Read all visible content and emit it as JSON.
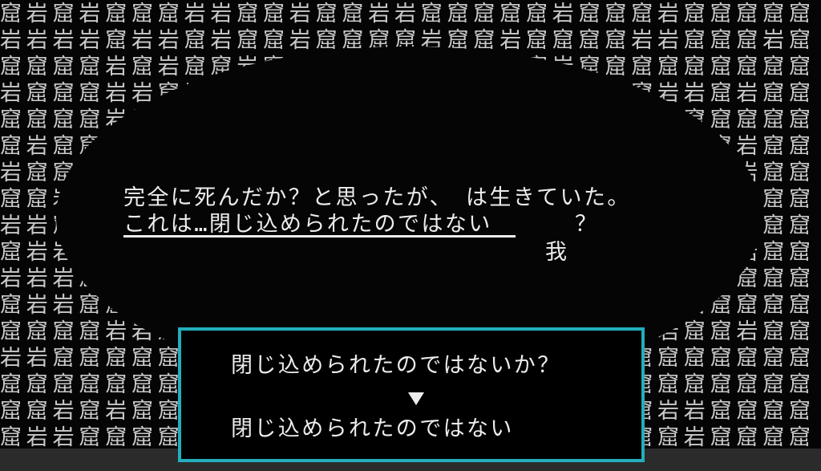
{
  "scene": {
    "rock_rows": [
      "窟岩窟岩窟窟窟岩岩窟窟岩窟窟岩岩窟窟窟窟窟岩窟窟窟岩窟窟窟窟窟",
      "岩岩岩岩窟岩岩窟岩窟窟岩窟窟窟窟岩窟窟岩窟窟窟窟岩岩窟窟窟岩窟",
      "窟窟窟窟岩窟岩窟窟岩窟岩窟岩窟窟窟窟岩窟窟岩窟窟窟窟窟窟窟窟窟",
      "岩窟窟窟岩岩窟岩窟窟窟窟窟窟岩窟窟窟窟岩窟窟窟窟窟岩岩窟岩窟窟",
      "窟窟窟窟岩岩窟窟岩窟窟窟岩窟窟窟窟窟窟窟窟窟窟窟岩岩窟窟窟窟窟",
      "窟岩窟窟窟岩岩窟岩岩窟窟窟窟窟窟岩窟窟窟窟窟窟窟窟窟窟窟岩窟窟",
      "岩窟窟窟窟窟窟窟岩窟窟窟窟岩窟窟窟窟窟窟窟窟岩窟窟窟窟窟岩窟窟",
      "窟窟岩窟窟窟窟窟窟窟窟窟窟窟窟窟窟窟窟窟窟窟窟窟窟窟窟窟窟窟窟",
      "岩岩窟窟窟窟窟窟窟岩窟岩窟窟窟窟窟窟窟窟窟窟窟窟窟窟窟窟岩窟窟",
      "窟岩岩窟窟窟窟岩窟窟窟窟窟窟窟窟窟窟窟窟窟窟窟窟窟窟窟窟岩窟窟",
      "岩岩岩窟窟窟窟窟窟窟窟窟窟窟窟窟窟窟窟窟窟窟窟窟窟窟窟窟窟窟窟",
      "窟岩岩窟窟窟窟窟窟窟窟窟窟窟窟窟窟窟窟窟窟窟窟窟窟岩窟窟窟窟窟",
      "窟窟窟窟岩岩窟窟窟窟窟窟窟窟窟窟窟窟窟窟窟窟窟窟窟岩窟窟岩窟窟",
      "岩岩窟窟窟窟窟岩窟窟窟窟窟窟窟窟窟窟窟窟窟窟岩岩窟窟窟窟窟窟窟",
      "窟窟窟窟窟窟窟窟窟窟窟窟窟窟窟窟窟窟窟窟窟窟窟窟窟窟窟窟窟窟窟",
      "窟窟岩窟岩窟窟窟窟窟窟窟窟窟窟窟窟窟窟窟窟窟窟窟窟岩岩窟窟窟窟",
      "窟岩岩窟窟窟窟窟窟窟窟窟窟窟窟窟窟窟窟窟窟窟窟窟窟窟岩窟窟窟窟"
    ]
  },
  "dialogue": {
    "line1": "完全に死んだか？と思ったが、　は生きていた。",
    "line2": "これは…閉じ込められたのではない　",
    "line2_tail": "？",
    "speaker_glyph": "我"
  },
  "choices": {
    "option_1": "閉じ込められたのではないか？",
    "option_2": "閉じ込められたのではない"
  },
  "colors": {
    "accent_border": "#23aebd",
    "text": "#ececec",
    "rock_text": "#c9c9c9",
    "background": "#050505"
  },
  "icons": {
    "advance": "down-triangle-icon"
  }
}
